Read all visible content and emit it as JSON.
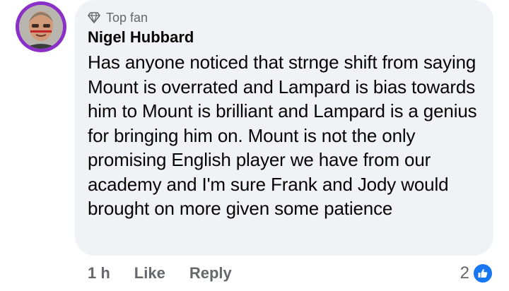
{
  "comment": {
    "badge": "Top fan",
    "badge_icon": "diamond-icon",
    "author": "Nigel Hubbard",
    "text": "Has anyone noticed that strnge shift from saying Mount is overrated and Lampard is bias towards him to Mount is brilliant and Lampard is a genius for bringing him on. Mount is not the only promising English player we have from our academy and I'm sure Frank and Jody would brought on more given some patience",
    "avatar_ring_color": "#8a2fc7",
    "bubble_color": "#f0f2f5"
  },
  "actions": {
    "time": "1 h",
    "like_label": "Like",
    "reply_label": "Reply"
  },
  "reactions": {
    "count": "2",
    "icon": "thumbs-up-icon",
    "color": "#1877f2"
  }
}
